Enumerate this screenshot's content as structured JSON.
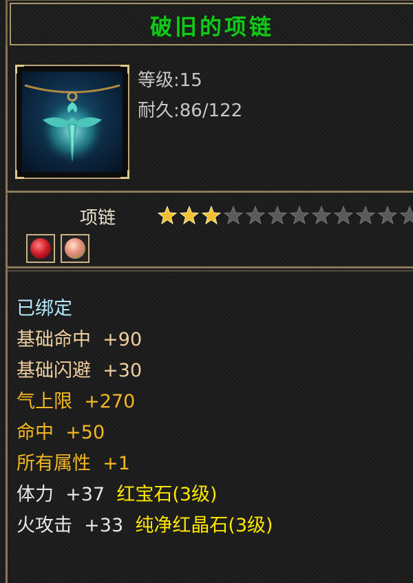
{
  "item": {
    "name": "破旧的项链",
    "level_text": "等级:15",
    "durability_text": "耐久:86/122",
    "type": "项链",
    "star_rating": {
      "filled": 3,
      "total": 12
    },
    "gem_slots": [
      {
        "name": "red-gem-icon",
        "color": "#d0202a"
      },
      {
        "name": "pink-gem-icon",
        "color": "#e88a7a"
      }
    ]
  },
  "attributes": {
    "bound": "已绑定",
    "base_hit": {
      "label": "基础命中",
      "value": "+90"
    },
    "base_dodge": {
      "label": "基础闪避",
      "value": "+30"
    },
    "qi_cap": {
      "label": "气上限",
      "value": "+270"
    },
    "hit": {
      "label": "命中",
      "value": "+50"
    },
    "all_attrs": {
      "label": "所有属性",
      "value": "+1"
    },
    "stamina": {
      "label": "体力",
      "value": "+37",
      "gem": "红宝石(3级)"
    },
    "fire_attack": {
      "label": "火攻击",
      "value": "+33",
      "gem": "纯净红晶石(3级)"
    }
  },
  "colors": {
    "title": "#14c81a",
    "bound": "#b8ecff",
    "base_stat": "#f0cfa0",
    "bonus_stat": "#f4b820",
    "gem_stat": "#e8e8e8",
    "gem_name": "#ffe800",
    "border": "#8a7a58"
  }
}
